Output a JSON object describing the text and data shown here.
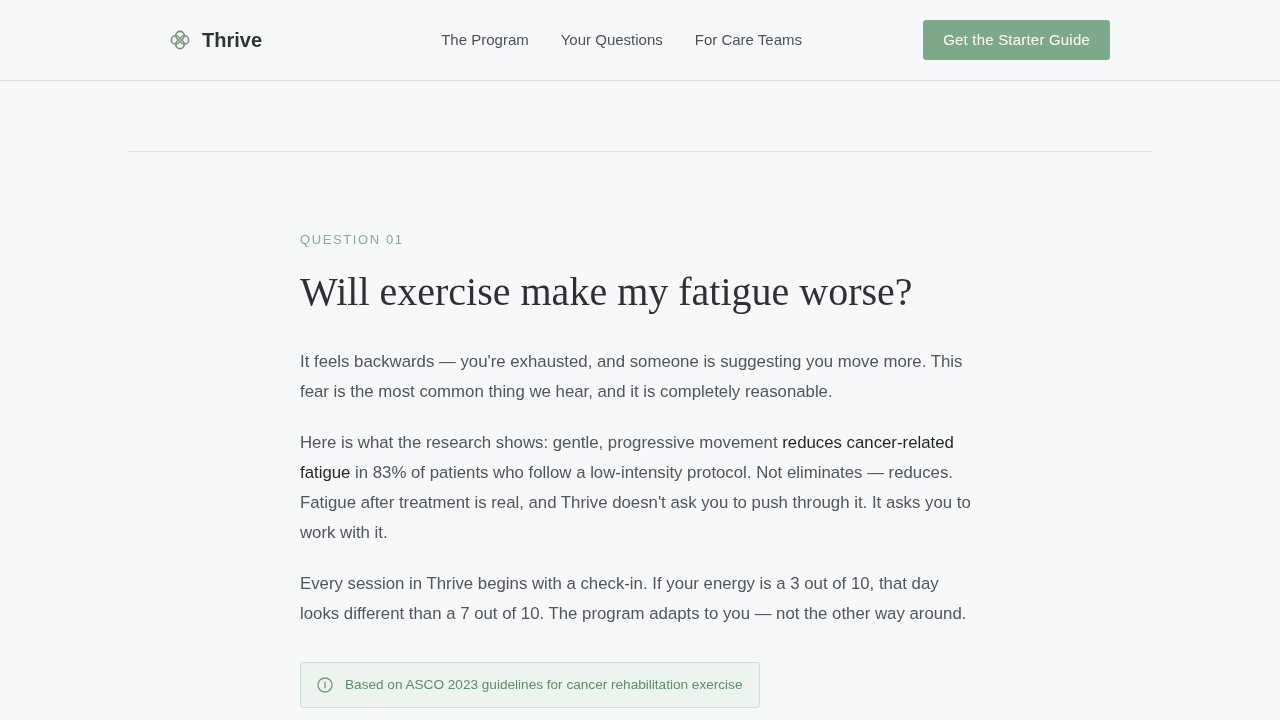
{
  "header": {
    "brand": "Thrive",
    "nav": [
      {
        "label": "The Program"
      },
      {
        "label": "Your Questions"
      },
      {
        "label": "For Care Teams"
      }
    ],
    "cta": "Get the Starter Guide"
  },
  "article": {
    "eyebrow": "QUESTION 01",
    "title": "Will exercise make my fatigue worse?",
    "paragraphs": [
      "It feels backwards — you're exhausted, and someone is suggesting you move more. This fear is the most common thing we hear, and it is completely reasonable.",
      "Here is what the research shows: gentle, progressive movement **reduces cancer-related fatigue** in 83% of patients who follow a low-intensity protocol. Not eliminates — reduces. Fatigue after treatment is real, and Thrive doesn't ask you to push through it. It asks you to work with it.",
      "Every session in Thrive begins with a check-in. If your energy is a 3 out of 10, that day looks different than a 7 out of 10. The program adapts to you — not the other way around."
    ],
    "source_note": "Based on ASCO 2023 guidelines for cancer rehabilitation exercise"
  }
}
